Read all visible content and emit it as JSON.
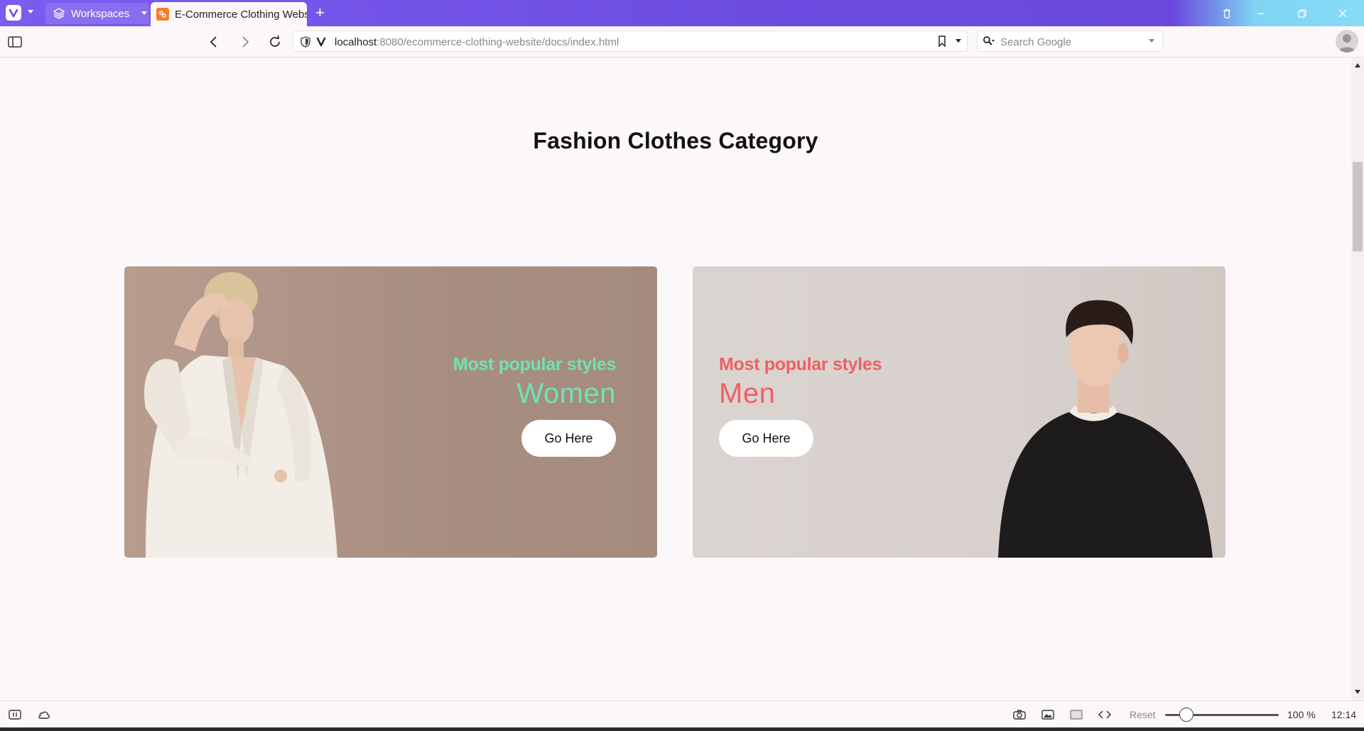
{
  "browser": {
    "workspaces_label": "Workspaces",
    "tab_title": "E-Commerce Clothing Website",
    "url_host": "localhost",
    "url_rest": ":8080/ecommerce-clothing-website/docs/index.html",
    "search_placeholder": "Search Google"
  },
  "page": {
    "title": "Fashion Clothes Category",
    "cards": [
      {
        "eyebrow": "Most popular styles",
        "category": "Women",
        "button": "Go Here",
        "accent": "#6ee3b3",
        "image": "woman-in-white-blazer"
      },
      {
        "eyebrow": "Most popular styles",
        "category": "Men",
        "button": "Go Here",
        "accent": "#f15f61",
        "image": "man-in-black-sweater"
      }
    ]
  },
  "statusbar": {
    "reset_label": "Reset",
    "zoom": "100 %",
    "clock": "12:14"
  },
  "colors": {
    "titlebar": "#6c4de0",
    "page_bg": "#fcf8f9"
  }
}
